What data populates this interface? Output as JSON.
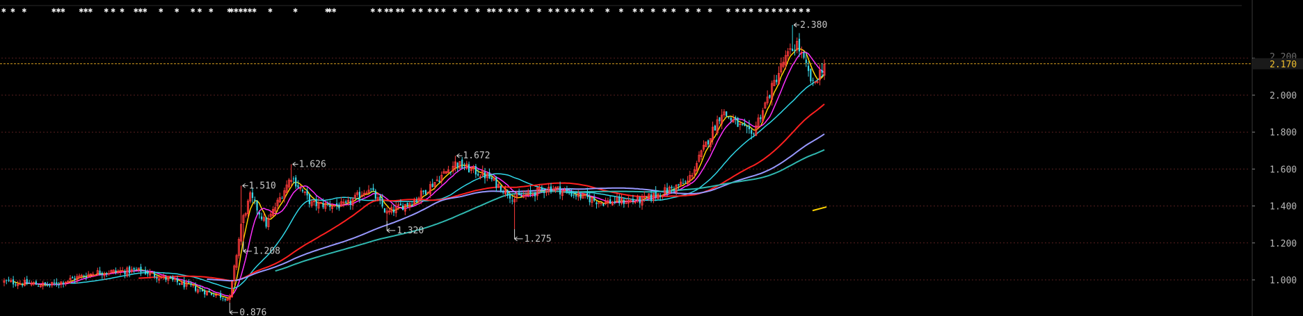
{
  "chart_data": {
    "type": "candlestick",
    "title": "",
    "xlabel": "",
    "ylabel": "",
    "ylim": [
      0.876,
      2.45
    ],
    "y_ticks": [
      1.0,
      1.2,
      1.4,
      1.6,
      1.8,
      2.0,
      2.2
    ],
    "y_tick_labels": [
      "1.000",
      "1.200",
      "1.400",
      "1.600",
      "1.800",
      "2.000",
      "2.200"
    ],
    "current_price": 2.17,
    "current_price_label": "2.170",
    "grid": true,
    "annotations": [
      {
        "label": "2.380",
        "value": 2.38,
        "kind": "high"
      },
      {
        "label": "1.626",
        "value": 1.626,
        "kind": "high"
      },
      {
        "label": "1.672",
        "value": 1.672,
        "kind": "high"
      },
      {
        "label": "1.510",
        "value": 1.51,
        "kind": "high"
      },
      {
        "label": "1.208",
        "value": 1.208,
        "kind": "low"
      },
      {
        "label": "1.320",
        "value": 1.32,
        "kind": "low"
      },
      {
        "label": "1.275",
        "value": 1.275,
        "kind": "low"
      },
      {
        "label": "0.876",
        "value": 0.876,
        "kind": "low"
      }
    ],
    "event_marker_symbol": "✱",
    "series_close_keypoints": [
      {
        "bar": 0,
        "close": 0.99
      },
      {
        "bar": 20,
        "close": 0.97
      },
      {
        "bar": 40,
        "close": 1.04
      },
      {
        "bar": 60,
        "close": 1.05
      },
      {
        "bar": 75,
        "close": 0.99
      },
      {
        "bar": 90,
        "close": 0.93
      },
      {
        "bar": 99,
        "close": 0.9
      },
      {
        "bar": 104,
        "close": 1.3
      },
      {
        "bar": 108,
        "close": 1.45
      },
      {
        "bar": 115,
        "close": 1.3
      },
      {
        "bar": 126,
        "close": 1.56
      },
      {
        "bar": 135,
        "close": 1.41
      },
      {
        "bar": 150,
        "close": 1.4
      },
      {
        "bar": 160,
        "close": 1.5
      },
      {
        "bar": 168,
        "close": 1.36
      },
      {
        "bar": 180,
        "close": 1.43
      },
      {
        "bar": 198,
        "close": 1.63
      },
      {
        "bar": 212,
        "close": 1.56
      },
      {
        "bar": 224,
        "close": 1.44
      },
      {
        "bar": 240,
        "close": 1.5
      },
      {
        "bar": 262,
        "close": 1.42
      },
      {
        "bar": 280,
        "close": 1.43
      },
      {
        "bar": 300,
        "close": 1.53
      },
      {
        "bar": 315,
        "close": 1.91
      },
      {
        "bar": 328,
        "close": 1.78
      },
      {
        "bar": 342,
        "close": 2.18
      },
      {
        "bar": 348,
        "close": 2.28
      },
      {
        "bar": 355,
        "close": 2.05
      },
      {
        "bar": 360,
        "close": 2.17
      }
    ],
    "moving_averages": [
      {
        "color": "#ffd400",
        "period": 5
      },
      {
        "color": "#ff30ff",
        "period": 10
      },
      {
        "color": "#30d8e8",
        "period": 30
      },
      {
        "color": "#ff2020",
        "period": 60
      },
      {
        "color": "#9898ff",
        "period": 90
      },
      {
        "color": "#30b8b0",
        "period": 120
      }
    ],
    "colors": {
      "up": "#ff3b3b",
      "down": "#38d8e8",
      "grid": "#5a2020",
      "current_line": "#d8a020",
      "background": "#000000"
    }
  }
}
